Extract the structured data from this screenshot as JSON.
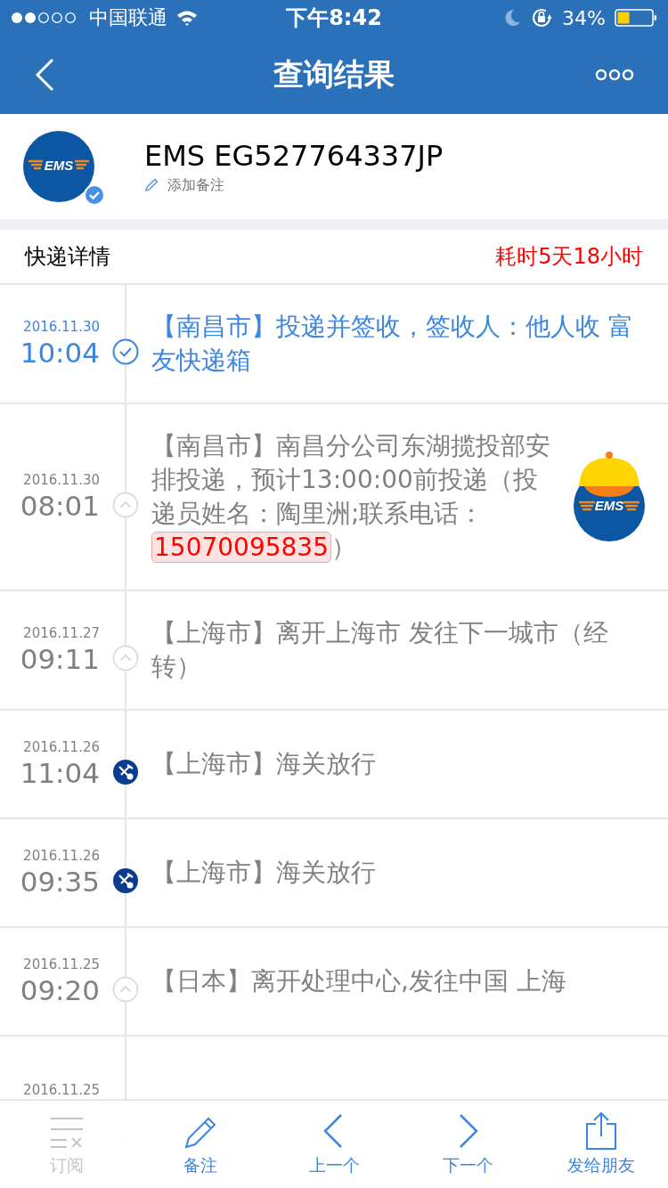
{
  "status_bar": {
    "carrier": "中国联通",
    "time": "下午8:42",
    "battery": "34%"
  },
  "nav": {
    "title": "查询结果"
  },
  "package": {
    "logo_text": "EMS",
    "verified": true,
    "tracking": "EMS EG527764337JP",
    "note_link": "添加备注"
  },
  "summary": {
    "label": "快递详情",
    "duration": "耗时5天18小时"
  },
  "events": [
    {
      "kind": "delivered",
      "date": "2016.11.30",
      "time": "10:04",
      "text": "【南昌市】投递并签收，签收人：他人收 富友快递箱"
    },
    {
      "kind": "normal",
      "date": "2016.11.30",
      "time": "08:01",
      "text": "【南昌市】南昌分公司东湖揽投部安排投递，预计13:00:00前投递（投递员姓名：陶里洲;联系电话：",
      "phone": "15070095835",
      "text_after": "）",
      "courier_logo_text": "EMS"
    },
    {
      "kind": "normal",
      "date": "2016.11.27",
      "time": "09:11",
      "text": "【上海市】离开上海市 发往下一城市（经转）"
    },
    {
      "kind": "customs",
      "date": "2016.11.26",
      "time": "11:04",
      "text": "【上海市】海关放行"
    },
    {
      "kind": "customs",
      "date": "2016.11.26",
      "time": "09:35",
      "text": "【上海市】海关放行"
    },
    {
      "kind": "normal",
      "date": "2016.11.25",
      "time": "09:20",
      "text": "【日本】离开处理中心,发往中国 上海"
    },
    {
      "date": "2016.11.25"
    }
  ],
  "tab_bar": [
    {
      "kind": "subscribe",
      "label": "订阅",
      "disabled": true
    },
    {
      "kind": "note",
      "label": "备注",
      "disabled": false
    },
    {
      "kind": "prev",
      "label": "上一个",
      "disabled": false
    },
    {
      "kind": "next",
      "label": "下一个",
      "disabled": false
    },
    {
      "kind": "share",
      "label": "发给朋友",
      "disabled": false
    }
  ]
}
